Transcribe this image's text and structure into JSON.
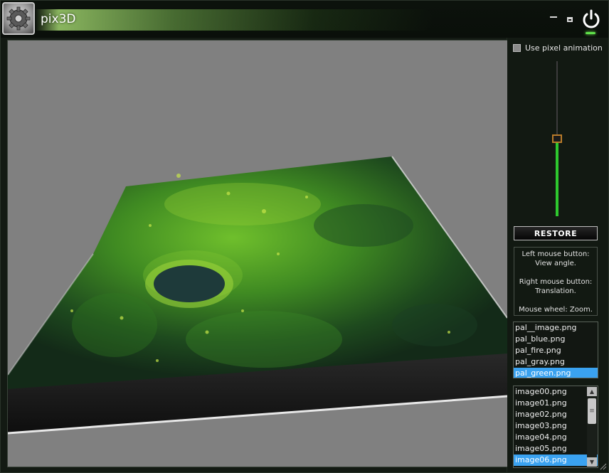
{
  "window": {
    "title": "pix3D",
    "icons": {
      "app": "gear-icon",
      "minimize": "minimize-icon",
      "maximize": "maximize-icon",
      "power": "power-icon"
    },
    "colors": {
      "accent": "#5fe04a",
      "selection": "#3aa2f0",
      "viewport_bg": "#808080",
      "slider_fill": "#2ec82e"
    }
  },
  "panel": {
    "pixel_animation": {
      "label": "Use pixel animation",
      "checked": false
    },
    "slider": {
      "value_fraction": 0.5
    },
    "restore_label": "RESTORE",
    "help": {
      "left_title": "Left mouse button:",
      "left_desc": "View angle.",
      "right_title": "Right mouse button:",
      "right_desc": "Translation.",
      "wheel": "Mouse wheel: Zoom."
    },
    "palettes": {
      "items": [
        "pal__image.png",
        "pal_blue.png",
        "pal_fire.png",
        "pal_gray.png",
        "pal_green.png"
      ],
      "selected": "pal_green.png"
    },
    "images": {
      "items": [
        "image00.png",
        "image01.png",
        "image02.png",
        "image03.png",
        "image04.png",
        "image05.png",
        "image06.png"
      ],
      "selected": "image06.png"
    }
  }
}
